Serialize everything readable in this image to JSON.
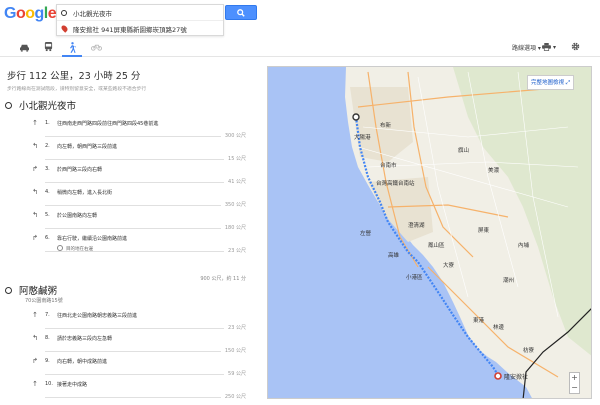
{
  "logo": {
    "letters": [
      "G",
      "o",
      "o",
      "g",
      "l",
      "e"
    ],
    "colors": [
      "#4285f4",
      "#ea4335",
      "#fbbc05",
      "#4285f4",
      "#34a853",
      "#ea4335"
    ]
  },
  "search": {
    "origin": "小北觀光夜市",
    "destination": "隆安掀社 941屏東縣新園鄉崁頂路27號"
  },
  "modes": [
    "car-icon",
    "transit-icon",
    "walk-icon",
    "bike-icon"
  ],
  "options": {
    "route_options": "路線選項 ▾",
    "print": "▾"
  },
  "summary": {
    "title": "步行 112 公里，23 小時 25 分",
    "note": "步行路線尚在測試階段，請特別留意安全，或某些路段不適合步行"
  },
  "origin_place": "小北觀光夜市",
  "dest_place": "阿憨鹹粥",
  "dest_address": "70公園南路15號",
  "steps_a": [
    {
      "num": "1.",
      "icon": "↑",
      "text": "往西南走西門路四段前往西門路四段45巷前進",
      "dist": "300 公尺"
    },
    {
      "num": "2.",
      "icon": "↰",
      "text": "向左轉，朝西門路三段前進",
      "dist": "15 公尺"
    },
    {
      "num": "3.",
      "icon": "↱",
      "text": "於西門路三段向右轉",
      "dist": "41 公尺"
    },
    {
      "num": "4.",
      "icon": "↰",
      "text": "稍微向左轉，進入長北街",
      "dist": "350 公尺"
    },
    {
      "num": "5.",
      "icon": "↰",
      "text": "於公園南路向左轉",
      "dist": "180 公尺"
    },
    {
      "num": "6.",
      "icon": "↱",
      "text": "靠右行駛，繼續沿公園南路前進",
      "dist": "23 公尺",
      "sub": "目的地在右邊"
    }
  ],
  "leg_total": "900 公尺，約 11 分",
  "steps_b": [
    {
      "num": "7.",
      "icon": "↑",
      "text": "往西北走公園南路朝忠義路三段前進",
      "dist": "23 公尺"
    },
    {
      "num": "8.",
      "icon": "↰",
      "text": "請於忠義路三段向左急轉",
      "dist": "150 公尺"
    },
    {
      "num": "9.",
      "icon": "↱",
      "text": "向右轉，朝中成路前進",
      "dist": "59 公尺"
    },
    {
      "num": "10.",
      "icon": "↑",
      "text": "接著走中成路",
      "dist": "250 公尺"
    }
  ],
  "map": {
    "fullscreen_label": "完整地圖檢視",
    "destination_label": "隆安掀社",
    "labels": [
      {
        "t": "大陽港",
        "k": "l0"
      },
      {
        "t": "布新",
        "k": "l1"
      },
      {
        "t": "台南市",
        "k": "l2"
      },
      {
        "t": "台灣高鐵台南站",
        "k": "l3"
      },
      {
        "t": "左營",
        "k": "l4"
      },
      {
        "t": "澄清湖",
        "k": "l5"
      },
      {
        "t": "高雄",
        "k": "l6"
      },
      {
        "t": "小港區",
        "k": "l7"
      },
      {
        "t": "鳳山區",
        "k": "l8"
      },
      {
        "t": "大寮",
        "k": "l9"
      },
      {
        "t": "屏東",
        "k": "l10"
      },
      {
        "t": "潮州",
        "k": "l11"
      },
      {
        "t": "東港",
        "k": "l12"
      },
      {
        "t": "林邊",
        "k": "l13"
      },
      {
        "t": "枋寮",
        "k": "l14"
      },
      {
        "t": "旗山",
        "k": "l15"
      },
      {
        "t": "美濃",
        "k": "l16"
      },
      {
        "t": "內埔",
        "k": "l17"
      }
    ],
    "route_color": "#4285f4"
  }
}
